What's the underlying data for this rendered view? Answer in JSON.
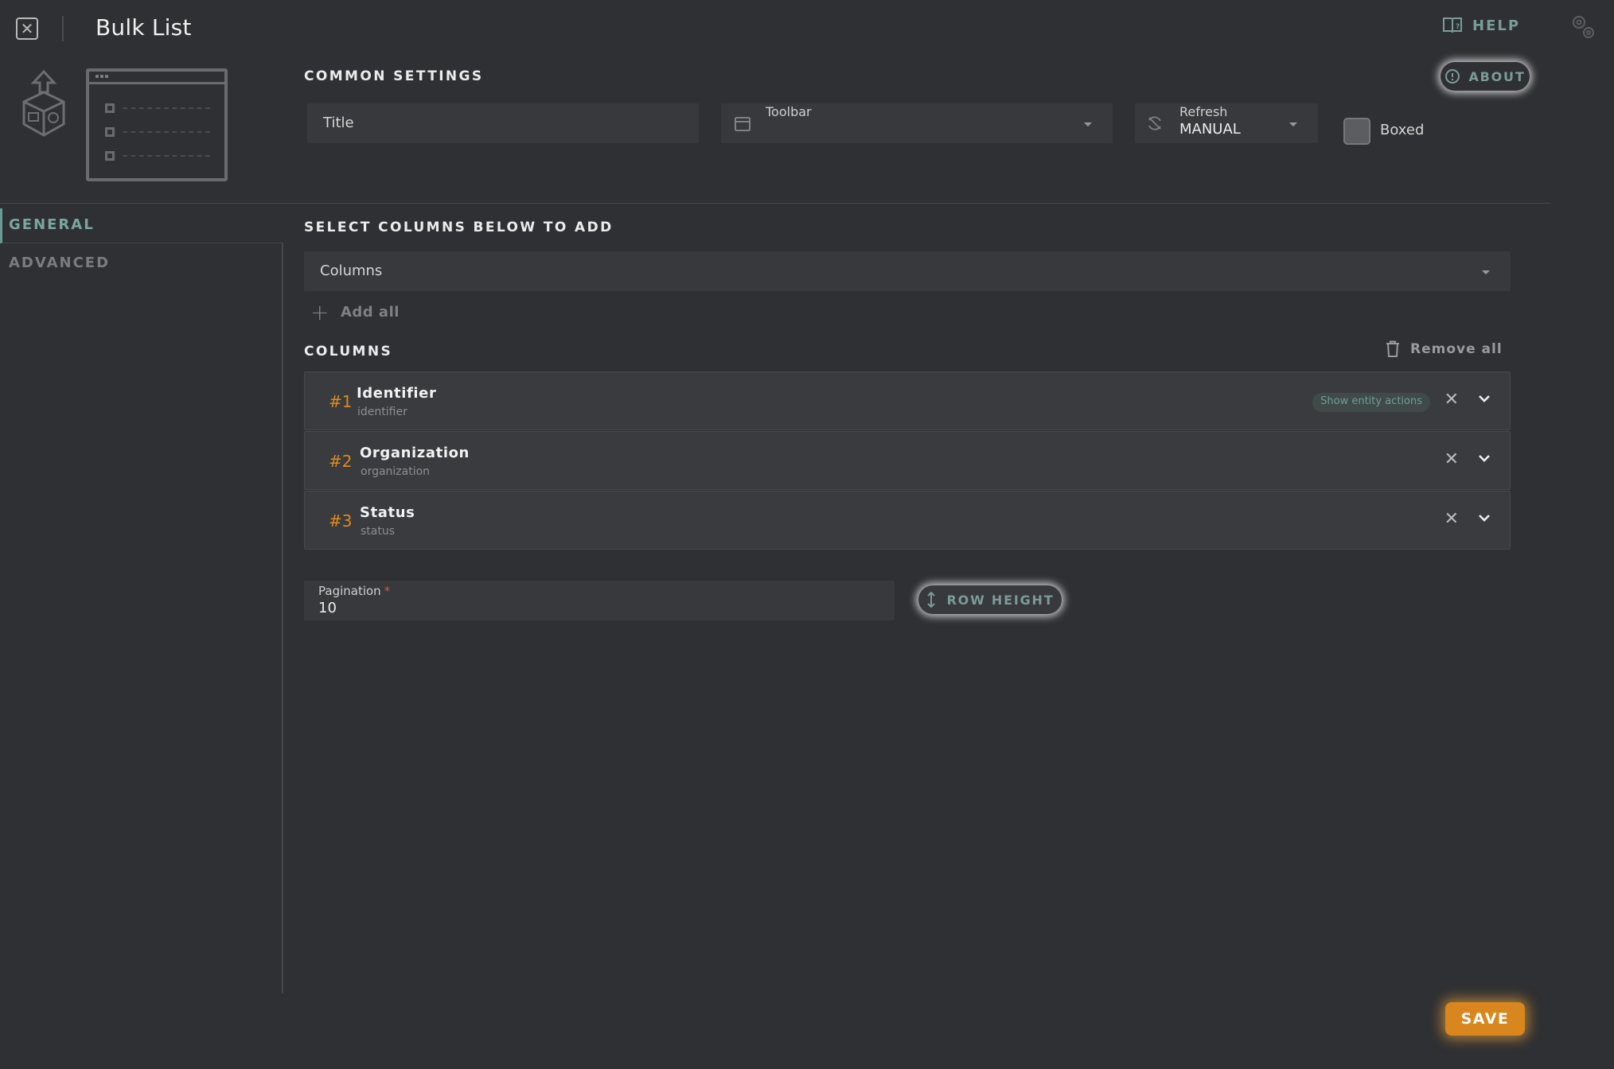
{
  "header": {
    "title": "Bulk List",
    "help_label": "HELP",
    "icons": [
      "close-icon",
      "help-book-icon",
      "gears-icon"
    ]
  },
  "common_settings": {
    "section_title": "COMMON SETTINGS",
    "about_label": "ABOUT",
    "title_placeholder": "Title",
    "toolbar_label": "Toolbar",
    "refresh_label": "Refresh",
    "refresh_value": "MANUAL",
    "boxed_label": "Boxed",
    "boxed_checked": false
  },
  "nav": {
    "items": [
      {
        "label": "GENERAL",
        "active": true
      },
      {
        "label": "ADVANCED",
        "active": false
      }
    ]
  },
  "main": {
    "select_title": "SELECT COLUMNS BELOW TO ADD",
    "columns_placeholder": "Columns",
    "add_all_label": "Add all",
    "columns_title": "COLUMNS",
    "remove_all_label": "Remove all",
    "columns": [
      {
        "num": "#1",
        "name": "Identifier",
        "key": "identifier",
        "badge": "Show entity actions"
      },
      {
        "num": "#2",
        "name": "Organization",
        "key": "organization",
        "badge": ""
      },
      {
        "num": "#3",
        "name": "Status",
        "key": "status",
        "badge": ""
      }
    ],
    "pagination_label": "Pagination",
    "pagination_required_mark": "*",
    "pagination_value": "10",
    "row_height_label": "ROW HEIGHT"
  },
  "footer": {
    "save_label": "SAVE"
  },
  "colors": {
    "accent_teal": "#7b9b9a",
    "accent_orange": "#dd8a1e",
    "save_orange": "#d8861d",
    "background": "#2f3033"
  }
}
